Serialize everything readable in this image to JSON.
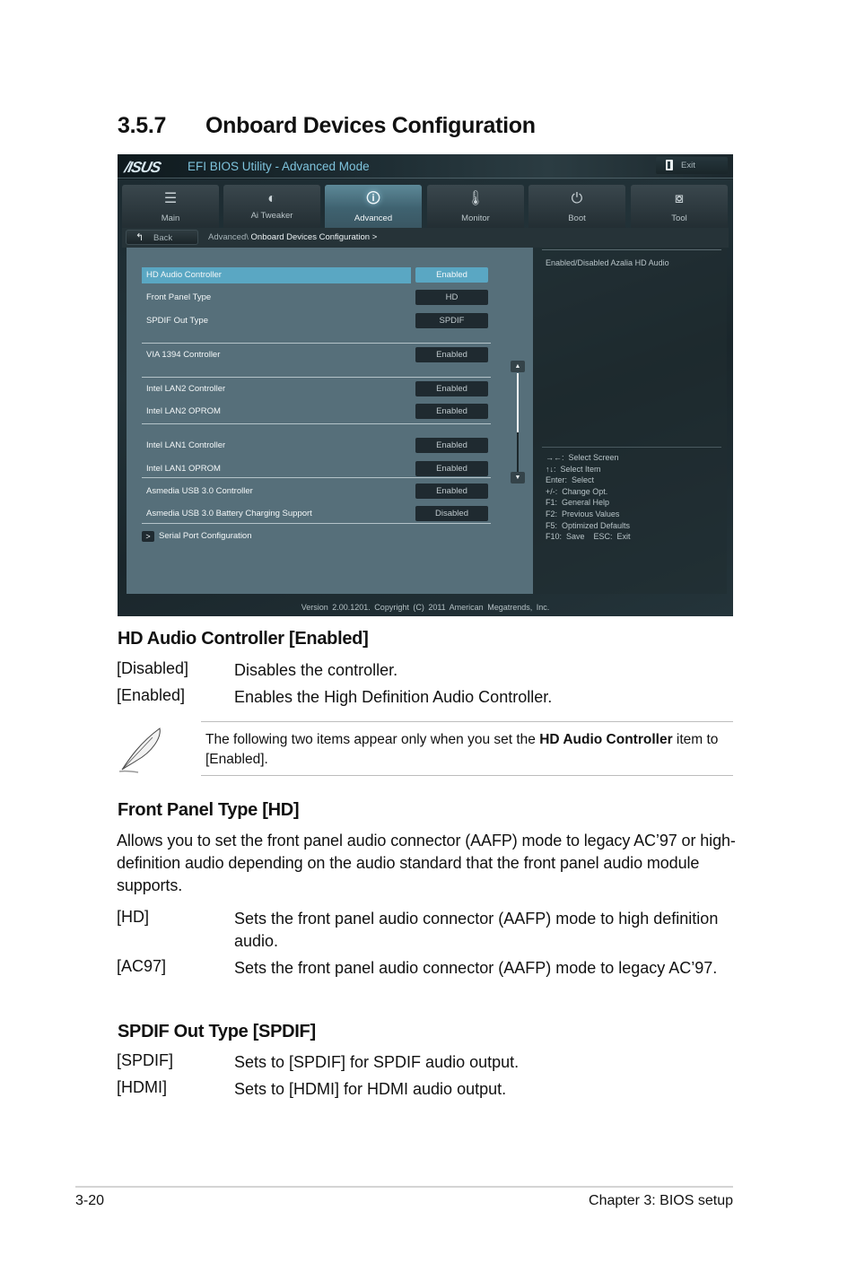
{
  "section": {
    "number": "3.5.7",
    "title": "Onboard Devices Configuration"
  },
  "bios": {
    "logo": "/ISUS",
    "title": "EFI BIOS Utility - Advanced Mode",
    "exit_label": "Exit",
    "tabs": [
      {
        "label": "Main",
        "icon": "list-icon",
        "glyph": "☰"
      },
      {
        "label": "Ai  Tweaker",
        "icon": "ai-tweaker-icon",
        "glyph": "◐"
      },
      {
        "label": "Advanced",
        "icon": "advanced-info-icon",
        "glyph": "🛈"
      },
      {
        "label": "Monitor",
        "icon": "thermometer-monitor-icon",
        "glyph": "🌡"
      },
      {
        "label": "Boot",
        "icon": "power-icon",
        "glyph": "⏻"
      },
      {
        "label": "Tool",
        "icon": "toolbox-icon",
        "glyph": "⧇"
      }
    ],
    "active_tab": "Advanced",
    "back_label": "Back",
    "breadcrumb": {
      "parent": "Advanced\\ ",
      "current": "Onboard Devices Configuration  >"
    },
    "items": [
      {
        "label": "HD Audio Controller",
        "value": "Enabled",
        "selected": true
      },
      {
        "label": "Front Panel Type",
        "value": "HD"
      },
      {
        "label": "SPDIF Out Type",
        "value": "SPDIF"
      },
      {
        "label": "VIA 1394 Controller",
        "value": "Enabled"
      },
      {
        "label": "Intel LAN2 Controller",
        "value": "Enabled"
      },
      {
        "label": "Intel LAN2 OPROM",
        "value": "Enabled"
      },
      {
        "label": "Intel LAN1 Controller",
        "value": "Enabled"
      },
      {
        "label": "Intel LAN1 OPROM",
        "value": "Enabled"
      },
      {
        "label": "Asmedia USB 3.0 Controller",
        "value": "Enabled"
      },
      {
        "label": "Asmedia USB 3.0 Battery Charging Support",
        "value": "Disabled"
      }
    ],
    "submenu": {
      "arrow": ">",
      "label": "Serial Port Configuration"
    },
    "scroll": {
      "up": "▲",
      "down": "▼",
      "position_fraction": 0.6
    },
    "help_text": "Enabled/Disabled Azalia HD Audio",
    "keys": [
      "→←:  Select Screen",
      "↑↓:  Select Item",
      "Enter:  Select",
      "+/-:  Change Opt.",
      "F1:  General Help",
      "F2:  Previous Values",
      "F5:  Optimized Defaults",
      "F10:  Save    ESC:  Exit"
    ],
    "footer": "Version  2.00.1201.  Copyright  (C)  2011  American  Megatrends,  Inc."
  },
  "hd_audio": {
    "heading": "HD Audio Controller [Enabled]",
    "options": [
      {
        "key": "[Disabled]",
        "desc": "Disables the controller."
      },
      {
        "key": "[Enabled]",
        "desc": "Enables the High Definition Audio Controller."
      }
    ]
  },
  "note": {
    "text_before": "The following two items appear only when you set the ",
    "bold": "HD Audio Controller",
    "text_after": " item to [Enabled]."
  },
  "front_panel": {
    "heading": "Front Panel Type [HD]",
    "description": "Allows you to set the front panel audio connector (AAFP) mode to legacy AC’97 or high-definition audio depending on the audio standard that the front panel audio module supports.",
    "options": [
      {
        "key": "[HD]",
        "desc": "Sets the front panel audio connector (AAFP) mode to high definition audio."
      },
      {
        "key": "[AC97]",
        "desc": "Sets the front panel audio connector (AAFP) mode to legacy AC’97."
      }
    ]
  },
  "spdif": {
    "heading": "SPDIF Out Type [SPDIF]",
    "options": [
      {
        "key": "[SPDIF]",
        "desc": "Sets to [SPDIF] for SPDIF audio output."
      },
      {
        "key": "[HDMI]",
        "desc": "Sets to [HDMI] for HDMI audio output."
      }
    ]
  },
  "footer": {
    "page": "3-20",
    "chapter": "Chapter 3: BIOS setup"
  }
}
